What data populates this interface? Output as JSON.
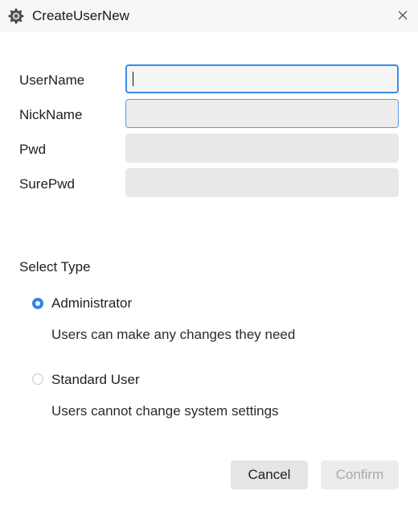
{
  "window": {
    "title": "CreateUserNew",
    "app_icon": "gear-icon",
    "close_icon": "close-icon"
  },
  "form": {
    "username_label": "UserName",
    "username_value": "",
    "nickname_label": "NickName",
    "nickname_value": "",
    "pwd_label": "Pwd",
    "pwd_value": "",
    "surepwd_label": "SurePwd",
    "surepwd_value": ""
  },
  "type_section": {
    "title": "Select Type",
    "options": [
      {
        "label": "Administrator",
        "description": "Users can make any changes they need",
        "selected": true
      },
      {
        "label": "Standard User",
        "description": "Users cannot change system settings",
        "selected": false
      }
    ]
  },
  "buttons": {
    "cancel_label": "Cancel",
    "confirm_label": "Confirm",
    "confirm_enabled": false
  },
  "colors": {
    "accent": "#2f86ea",
    "focus_border": "#3c8ce6",
    "field_bg": "#e8e8e8",
    "disabled_text": "#a9a9a9"
  }
}
